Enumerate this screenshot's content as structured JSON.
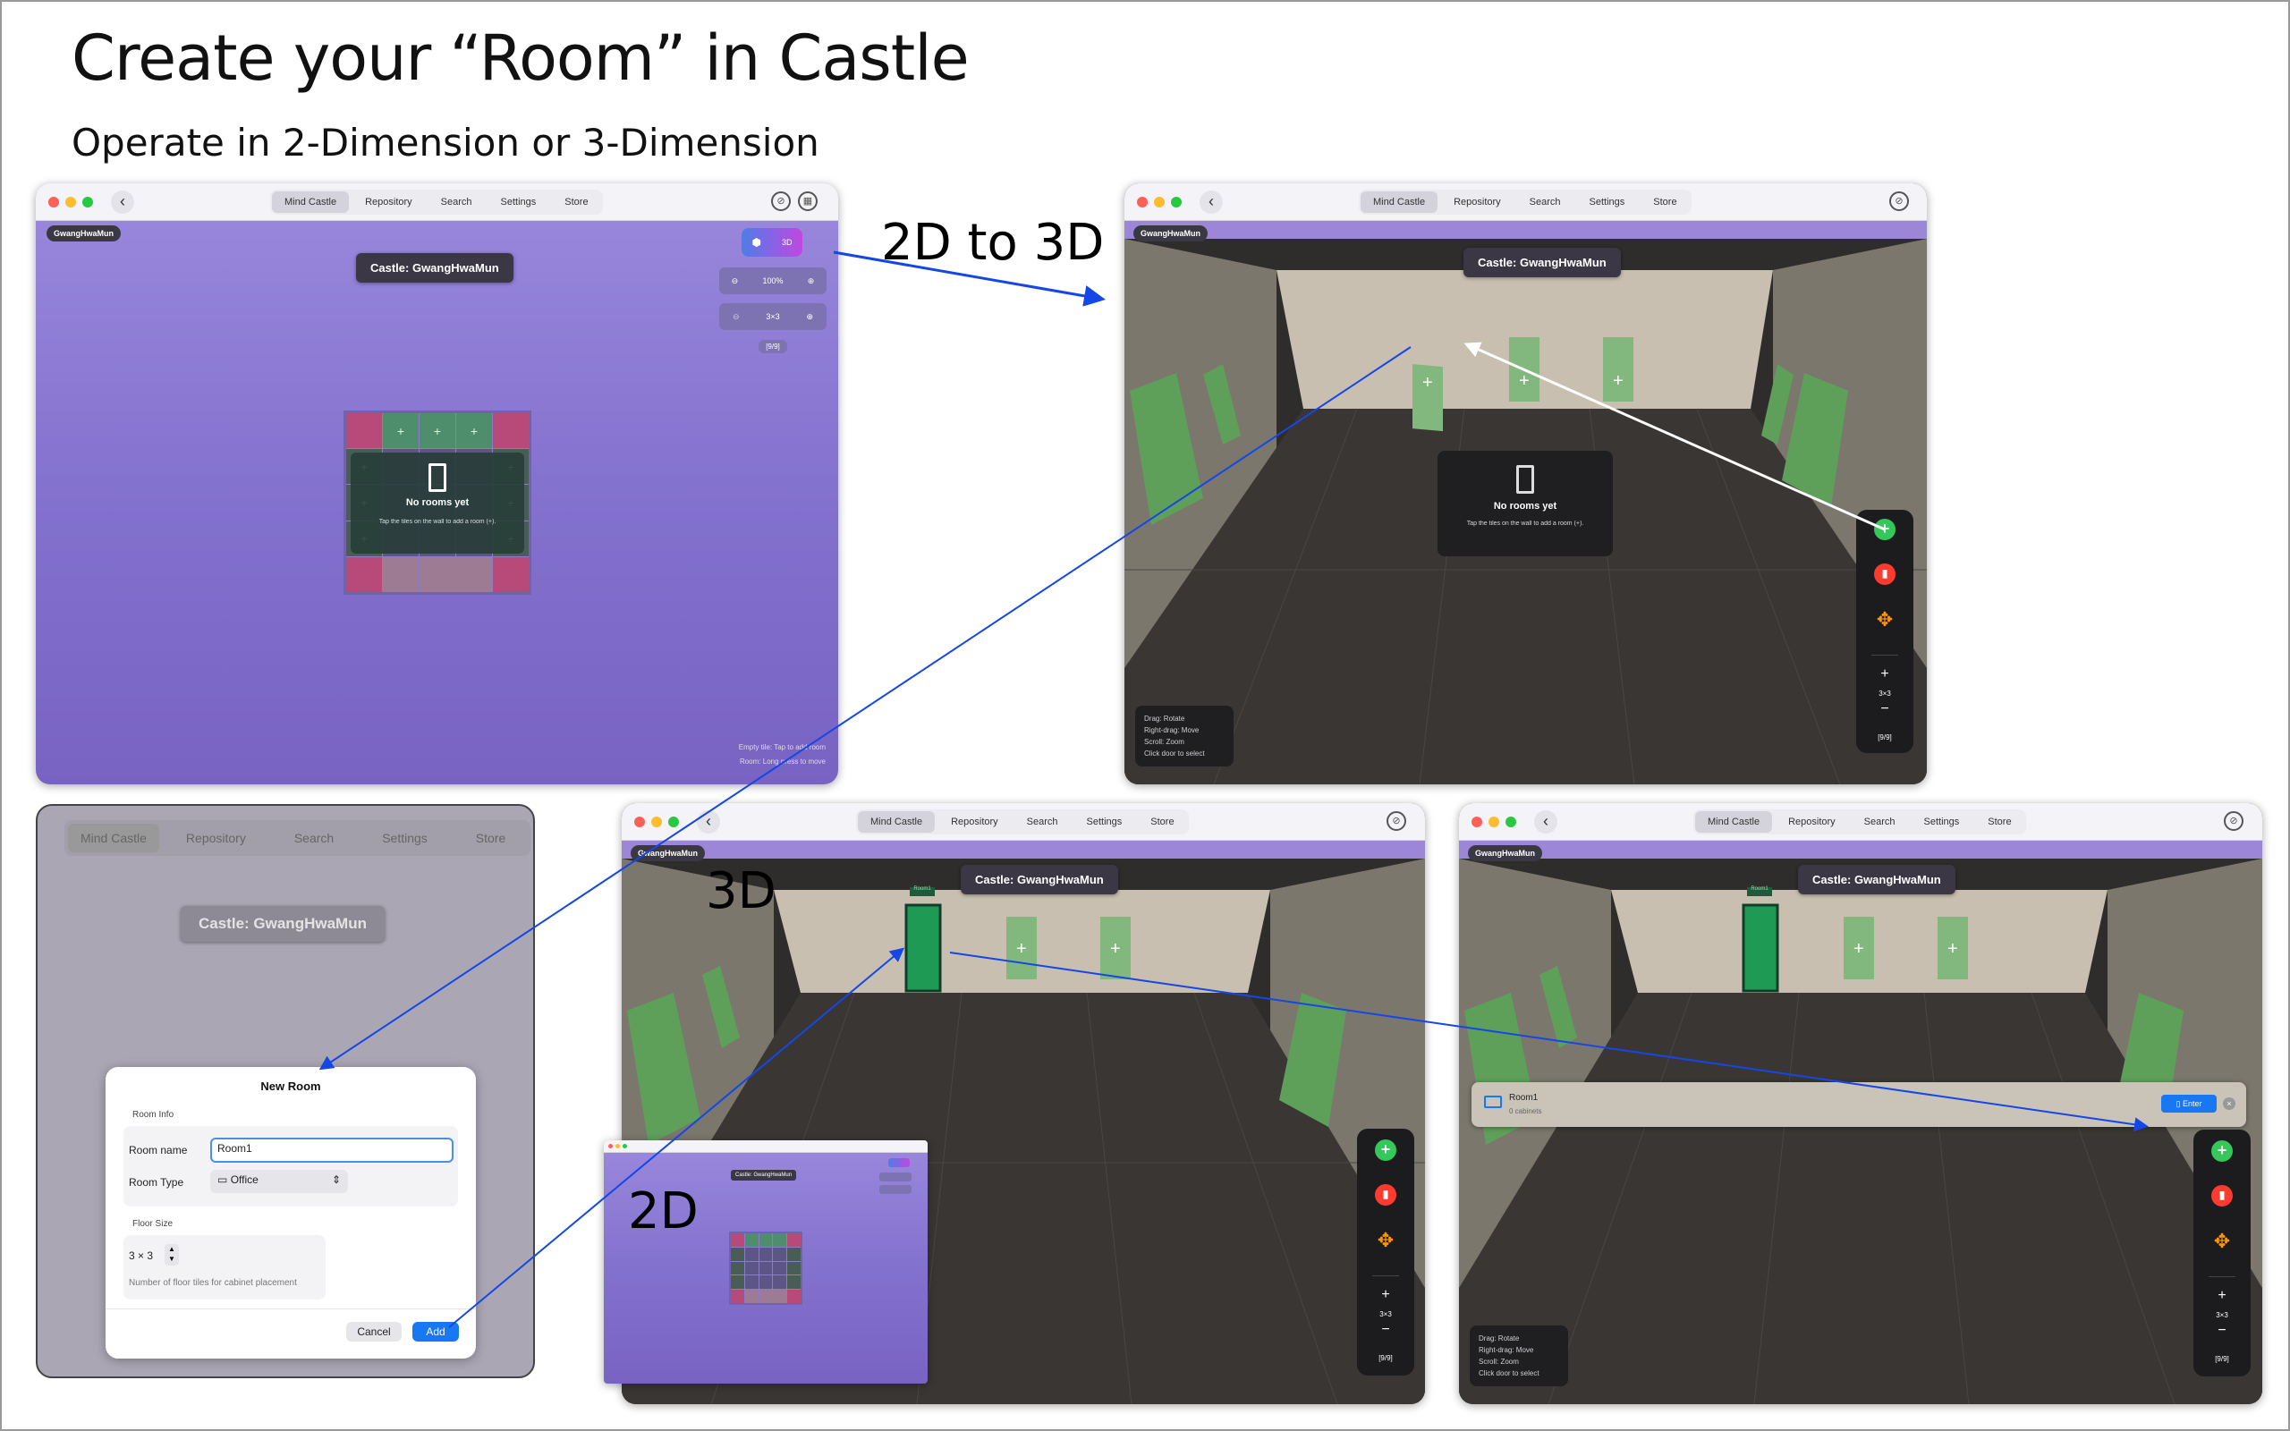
{
  "heading": {
    "title": "Create your “Room” in Castle",
    "subtitle": "Operate in 2-Dimension or 3-Dimension"
  },
  "captions": {
    "to3d": "2D to 3D",
    "three_d": "3D",
    "two_d": "2D"
  },
  "nav": {
    "tabs": [
      "Mind Castle",
      "Repository",
      "Search",
      "Settings",
      "Store"
    ],
    "active_tab": "Mind Castle"
  },
  "castle": {
    "user_chip": "GwangHwaMun",
    "title": "Castle: GwangHwaMun"
  },
  "view2d": {
    "mode_button": "3D",
    "zoom_level": "100%",
    "grid_size": "3×3",
    "counter": "[9/9]",
    "empty_title": "No rooms yet",
    "empty_hint": "Tap the tiles on the wall to add a room (+).",
    "hint_line1": "Empty tile: Tap to add room",
    "hint_line2": "Room: Long press to move"
  },
  "view3d": {
    "empty_title": "No rooms yet",
    "empty_hint": "Tap the tiles on the wall to add a room (+).",
    "help": [
      "Drag: Rotate",
      "Right-drag: Move",
      "Scroll: Zoom",
      "Click door to select"
    ],
    "grid_size": "3×3",
    "counter": "[9/9]",
    "door_label": "Room1"
  },
  "toolbar_icons": {
    "add": "plus-circle-icon",
    "delete": "trash-icon",
    "move": "move-arrows-icon",
    "zoom_in": "plus-icon",
    "zoom_out": "minus-icon"
  },
  "colors": {
    "purple": "#8472cf",
    "accent_blue": "#1877f2",
    "arrow_blue": "#1447e6",
    "green": "#34c759",
    "red": "#ff3b30",
    "orange": "#ff9500",
    "door_green": "#1e9a55"
  },
  "dialog": {
    "title": "New Room",
    "room_info": "Room Info",
    "room_name_label": "Room name",
    "room_name_value": "Room1",
    "room_type_label": "Room Type",
    "room_type_value": "Office",
    "floor_size_label": "Floor Size",
    "floor_size_value": "3 × 3",
    "floor_hint": "Number of floor tiles for cabinet placement",
    "cancel": "Cancel",
    "add": "Add"
  },
  "room_row": {
    "name": "Room1",
    "subtitle": "0 cabinets",
    "enter": "Enter"
  }
}
